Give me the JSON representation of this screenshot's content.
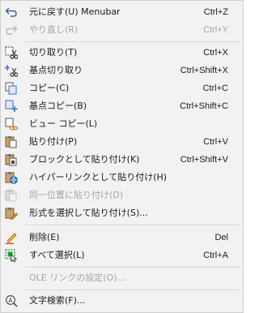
{
  "menu": {
    "items": [
      {
        "icon": "undo-icon",
        "label": "元に戻す(U) Menubar",
        "shortcut": "Ctrl+Z",
        "disabled": false
      },
      {
        "icon": "redo-icon",
        "label": "やり直し(R)",
        "shortcut": "Ctrl+Y",
        "disabled": true
      },
      {
        "icon": "cut-icon",
        "label": "切り取り(T)",
        "shortcut": "Ctrl+X",
        "disabled": false
      },
      {
        "icon": "cut-with-basepoint-icon",
        "label": "基点切り取り",
        "shortcut": "Ctrl+Shift+X",
        "disabled": false
      },
      {
        "icon": "copy-icon",
        "label": "コピー(C)",
        "shortcut": "Ctrl+C",
        "disabled": false
      },
      {
        "icon": "copy-with-basepoint-icon",
        "label": "基点コピー(B)",
        "shortcut": "Ctrl+Shift+C",
        "disabled": false
      },
      {
        "icon": "copy-link-icon",
        "label": "ビュー コピー(L)",
        "shortcut": "",
        "disabled": false
      },
      {
        "icon": "paste-icon",
        "label": "貼り付け(P)",
        "shortcut": "Ctrl+V",
        "disabled": false
      },
      {
        "icon": "paste-as-block-icon",
        "label": "ブロックとして貼り付け(K)",
        "shortcut": "Ctrl+Shift+V",
        "disabled": false
      },
      {
        "icon": "paste-as-hyperlink-icon",
        "label": "ハイパーリンクとして貼り付け(H)",
        "shortcut": "",
        "disabled": false
      },
      {
        "icon": "paste-to-original-coords-icon",
        "label": "同一位置に貼り付け(D)",
        "shortcut": "",
        "disabled": true
      },
      {
        "icon": "paste-special-icon",
        "label": "形式を選択して貼り付け(S)...",
        "shortcut": "",
        "disabled": false
      },
      {
        "icon": "erase-icon",
        "label": "削除(E)",
        "shortcut": "Del",
        "disabled": false
      },
      {
        "icon": "select-all-icon",
        "label": "すべて選択(L)",
        "shortcut": "Ctrl+A",
        "disabled": false
      },
      {
        "icon": "",
        "label": "OLE リンクの設定(O)...",
        "shortcut": "",
        "disabled": true
      },
      {
        "icon": "find-text-icon",
        "label": "文字検索(F)...",
        "shortcut": "",
        "disabled": false
      }
    ]
  }
}
